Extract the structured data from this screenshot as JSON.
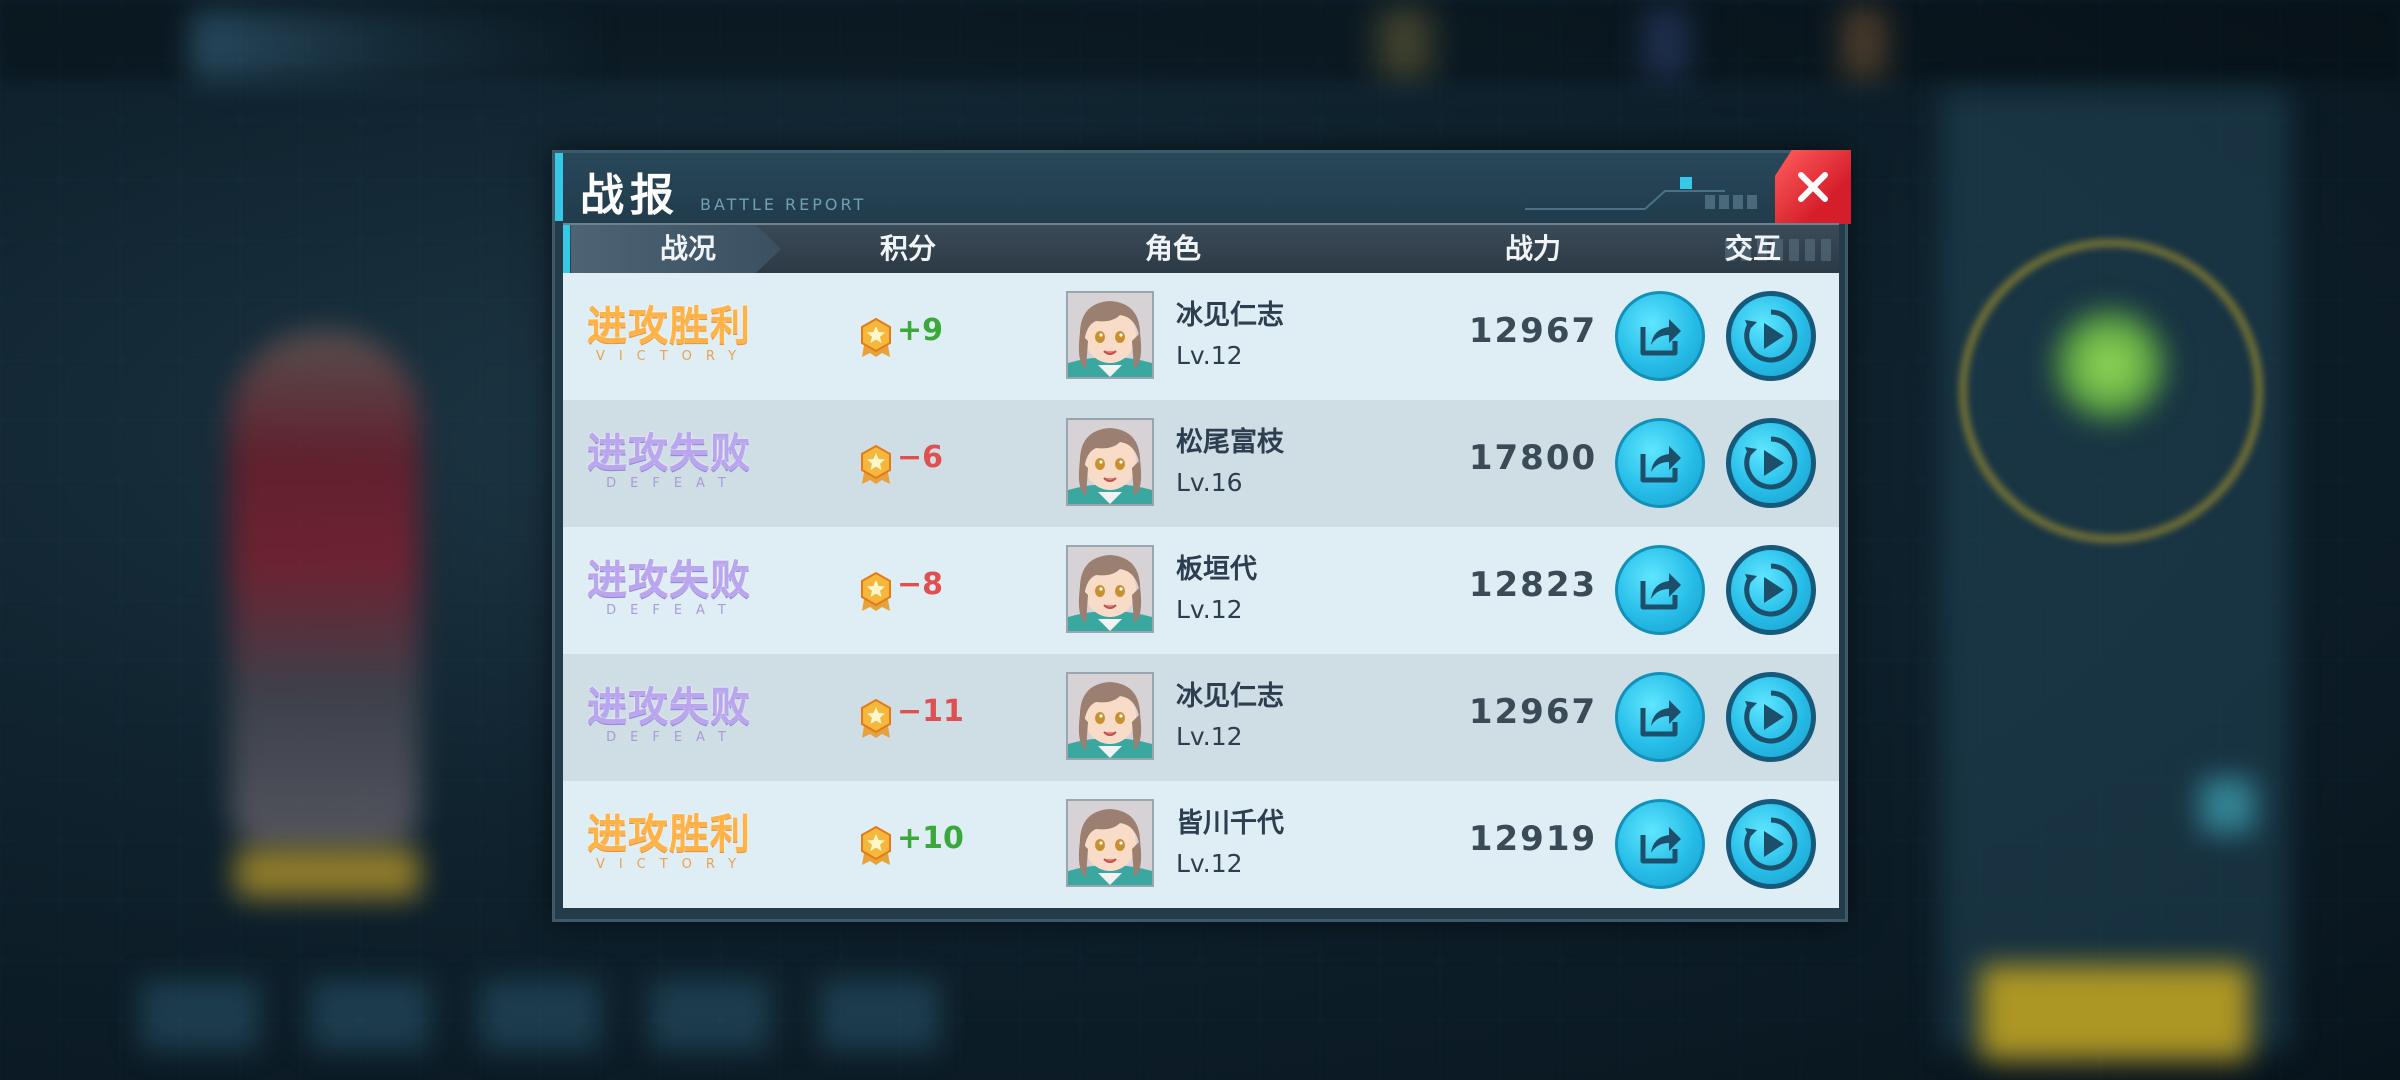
{
  "dialog": {
    "title": "战报",
    "subtitle": "BATTLE REPORT"
  },
  "table": {
    "headers": [
      "战况",
      "积分",
      "角色",
      "战力",
      "交互"
    ],
    "rows": [
      {
        "result_cn": "进攻胜利",
        "result_en": "VICTORY",
        "outcome": "victory",
        "score": "+9",
        "name": "冰见仁志",
        "level": "Lv.12",
        "power": "12967"
      },
      {
        "result_cn": "进攻失败",
        "result_en": "DEFEAT",
        "outcome": "defeat",
        "score": "−6",
        "name": "松尾富枝",
        "level": "Lv.16",
        "power": "17800"
      },
      {
        "result_cn": "进攻失败",
        "result_en": "DEFEAT",
        "outcome": "defeat",
        "score": "−8",
        "name": "板垣代",
        "level": "Lv.12",
        "power": "12823"
      },
      {
        "result_cn": "进攻失败",
        "result_en": "DEFEAT",
        "outcome": "defeat",
        "score": "−11",
        "name": "冰见仁志",
        "level": "Lv.12",
        "power": "12967"
      },
      {
        "result_cn": "进攻胜利",
        "result_en": "VICTORY",
        "outcome": "victory",
        "score": "+10",
        "name": "皆川千代",
        "level": "Lv.12",
        "power": "12919"
      }
    ]
  },
  "icons": {
    "close": "close-icon",
    "share": "share-icon",
    "replay": "play-icon",
    "medal": "star-medal-icon"
  },
  "colors": {
    "accent": "#37c8e8",
    "victory": "#ffb347",
    "defeat": "#b9a6ee",
    "score_positive": "#3aa83a",
    "score_negative": "#e05050",
    "close_button": "#e02b35"
  }
}
